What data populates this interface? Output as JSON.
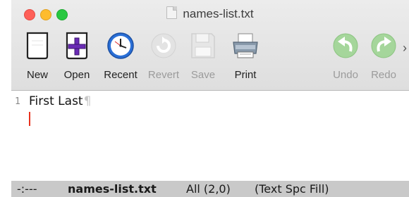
{
  "window": {
    "title": "names-list.txt"
  },
  "toolbar": {
    "items": [
      {
        "label": "New",
        "icon": "new-file-icon",
        "enabled": true
      },
      {
        "label": "Open",
        "icon": "open-file-icon",
        "enabled": true
      },
      {
        "label": "Recent",
        "icon": "clock-icon",
        "enabled": true
      },
      {
        "label": "Revert",
        "icon": "revert-icon",
        "enabled": false
      },
      {
        "label": "Save",
        "icon": "floppy-disk-icon",
        "enabled": false
      },
      {
        "label": "Print",
        "icon": "printer-icon",
        "enabled": true
      },
      {
        "label": "Undo",
        "icon": "undo-arrow-icon",
        "enabled": false
      },
      {
        "label": "Redo",
        "icon": "redo-arrow-icon",
        "enabled": false
      }
    ],
    "overflow_glyph": "›"
  },
  "editor": {
    "line_number": "1",
    "line_text": "First Last",
    "pilcrow": "¶",
    "cursor_color": "#e8321e"
  },
  "modeline": {
    "flags": "-:---",
    "filename": "names-list.txt",
    "position": "All (2,0)",
    "modes": "(Text Spc Fill)"
  }
}
